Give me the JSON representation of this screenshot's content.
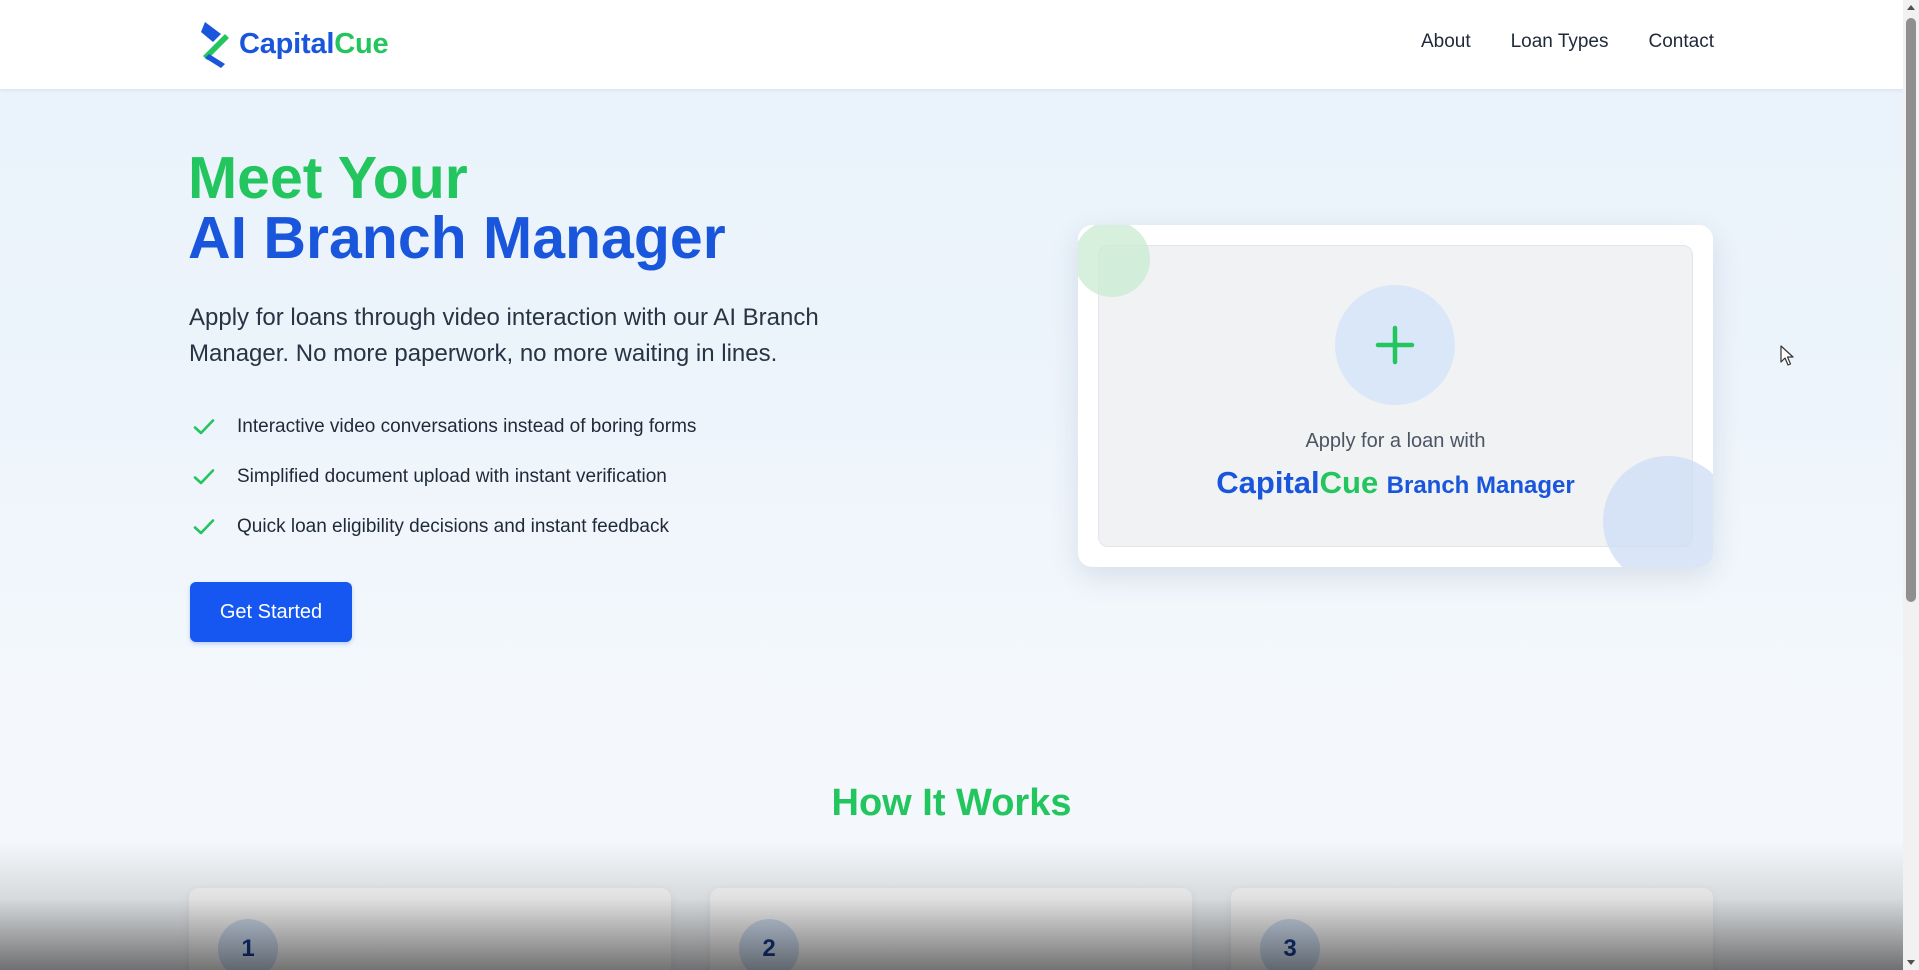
{
  "header": {
    "logo": {
      "part1": "Capital",
      "part2": "Cue"
    },
    "nav": [
      {
        "label": "About"
      },
      {
        "label": "Loan Types"
      },
      {
        "label": "Contact"
      }
    ]
  },
  "hero": {
    "title_line1": "Meet Your",
    "title_line2": "AI Branch Manager",
    "description": "Apply for loans through video interaction with our AI Branch Manager. No more paperwork, no more waiting in lines.",
    "features": [
      {
        "text": "Interactive video conversations instead of boring forms"
      },
      {
        "text": "Simplified document upload with instant verification"
      },
      {
        "text": "Quick loan eligibility decisions and instant feedback"
      }
    ],
    "cta_label": "Get Started"
  },
  "card": {
    "apply_text": "Apply for a loan with",
    "brand_part1": "Capital",
    "brand_part2": "Cue",
    "brand_suffix": "Branch Manager"
  },
  "how_it_works": {
    "title": "How It Works",
    "steps": [
      {
        "number": "1"
      },
      {
        "number": "2"
      },
      {
        "number": "3"
      }
    ]
  },
  "colors": {
    "brand_blue": "#1a56db",
    "brand_green": "#22c55e",
    "button_blue": "#1557f0"
  },
  "icons": [
    "logo-s-icon",
    "check-icon",
    "plus-icon",
    "mouse-cursor-icon",
    "scroll-up-arrow-icon",
    "scroll-down-arrow-icon"
  ]
}
